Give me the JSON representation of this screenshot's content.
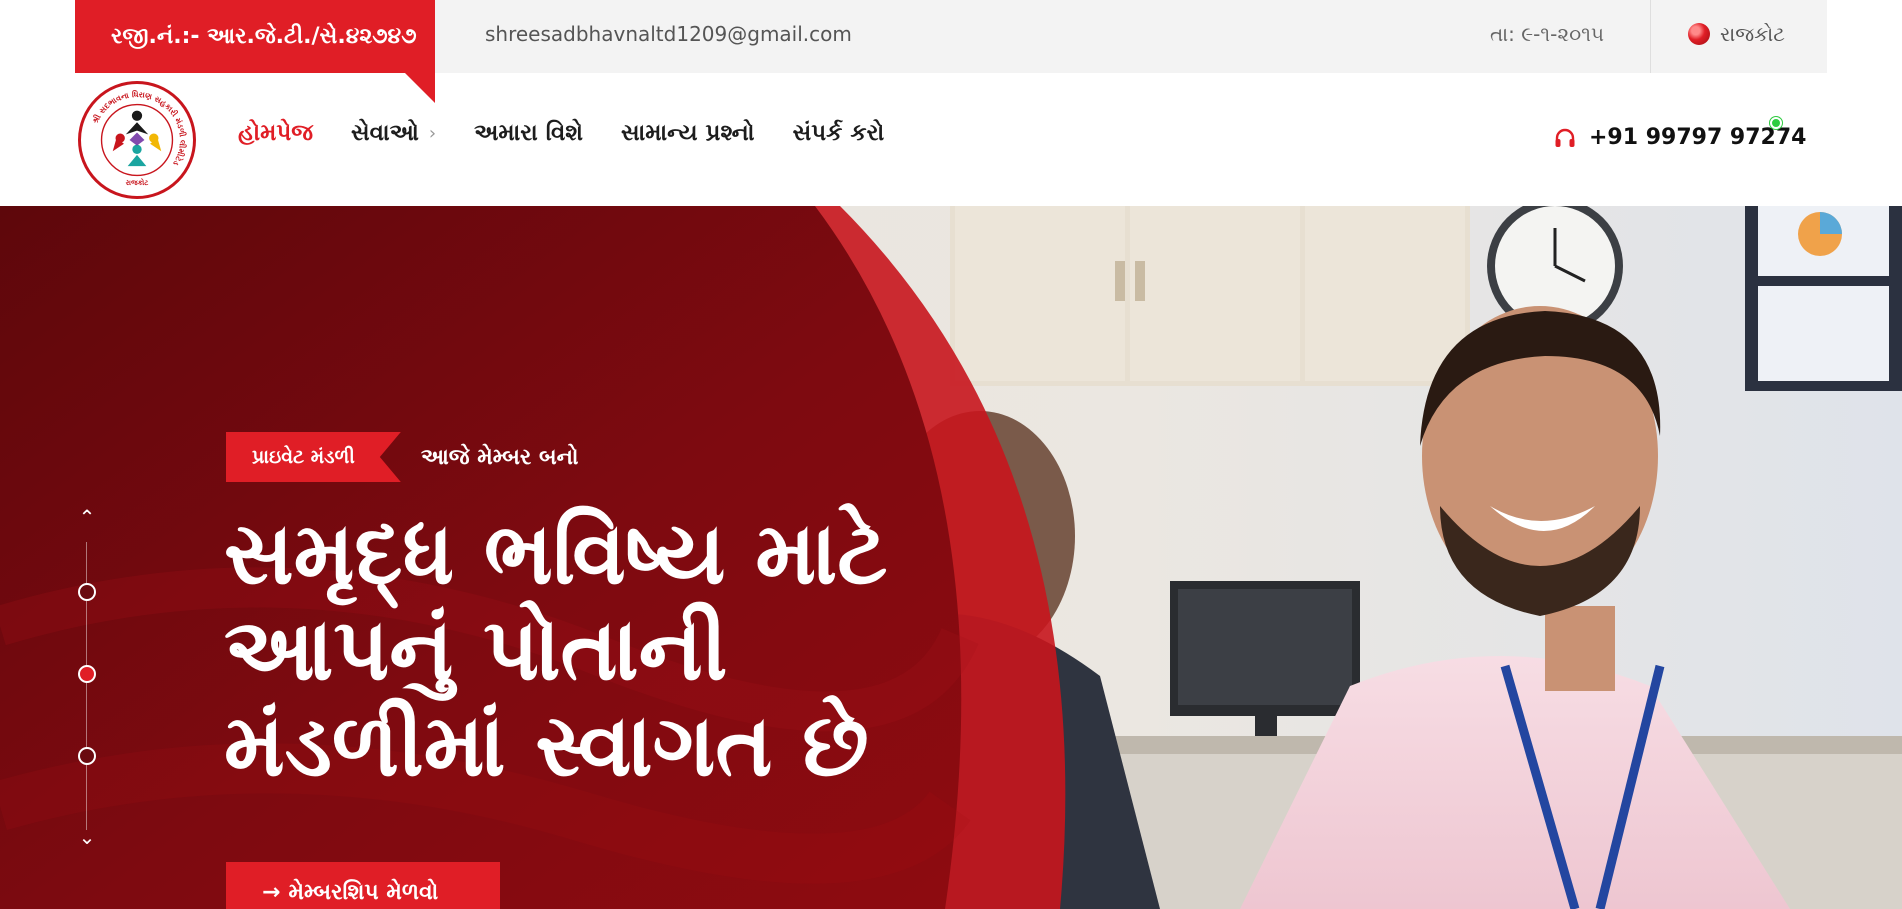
{
  "topbar": {
    "registration": "રજી.નં.:- આર.જે.ટી./સે.૪૨૭૪૭",
    "email": "shreesadbhavnaltd1209@gmail.com",
    "date": "તા: ૯-૧-૨૦૧૫",
    "city": "રાજકોટ"
  },
  "logo": {
    "ring_text": "શ્રી સદભાવના ધિરાણ સહકારી મંડળી લીમીટેડ",
    "bottom_text": "રાજકોટ"
  },
  "nav": {
    "home": "હોમપેજ",
    "services": "સેવાઓ",
    "about": "અમારા વિશે",
    "faq": "સામાન્ય પ્રશ્નો",
    "contact": "સંપર્ક કરો"
  },
  "contact": {
    "phone": "+91 99797 97274"
  },
  "hero": {
    "tag": "પ્રાઇવેટ મંડળી",
    "tagline": "આજે મેમ્બર બનો",
    "headline": [
      "સમૃદ્ધ ભવિષ્ય માટે",
      "આપનું પોતાની",
      "મંડળીમાં સ્વાગત છે"
    ],
    "cta_arrow": "→",
    "cta": "મેમ્બરશિપ મેળવો",
    "slider": {
      "prev": "⌃",
      "next": "⌄",
      "active_index": 1
    }
  },
  "colors": {
    "accent": "#e01e26",
    "hero_red": "#8e0b10",
    "topbar_bg": "#f3f3f3"
  }
}
